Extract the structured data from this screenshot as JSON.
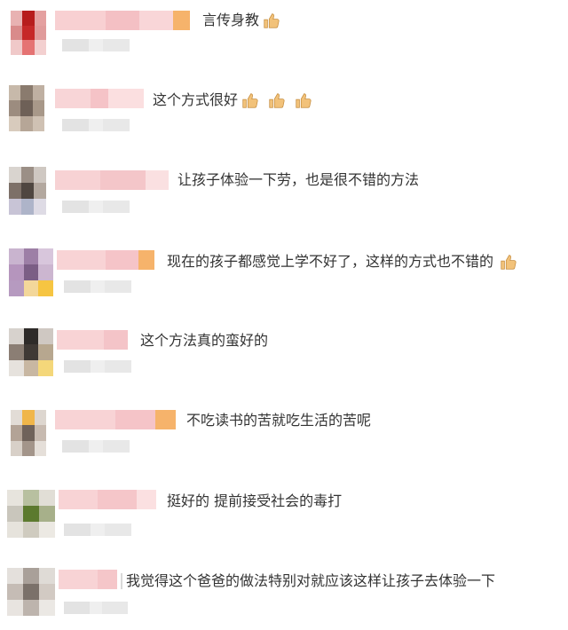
{
  "comments": [
    {
      "text": "言传身教",
      "thumbs": 1
    },
    {
      "text": "这个方式很好",
      "thumbs": 3
    },
    {
      "text": "让孩子体验一下劳，也是很不错的方法",
      "thumbs": 0
    },
    {
      "text": "现在的孩子都感觉上学不好了，这样的方式也不错的",
      "thumbs": 1
    },
    {
      "text": "这个方法真的蛮好的",
      "thumbs": 0
    },
    {
      "text": "不吃读书的苦就吃生活的苦呢",
      "thumbs": 0
    },
    {
      "text": "挺好的 提前接受社会的毒打",
      "thumbs": 0
    },
    {
      "text": "我觉得这个爸爸的做法特别对就应该这样让孩子去体验一下",
      "thumbs": 0
    }
  ],
  "icons": {
    "thumb": "thumbs-up-icon"
  },
  "colors": {
    "text": "#333333",
    "name_blur": "#f6c9cc",
    "meta_blur": "#e6e6e6",
    "thumb": "#f2c27a"
  }
}
